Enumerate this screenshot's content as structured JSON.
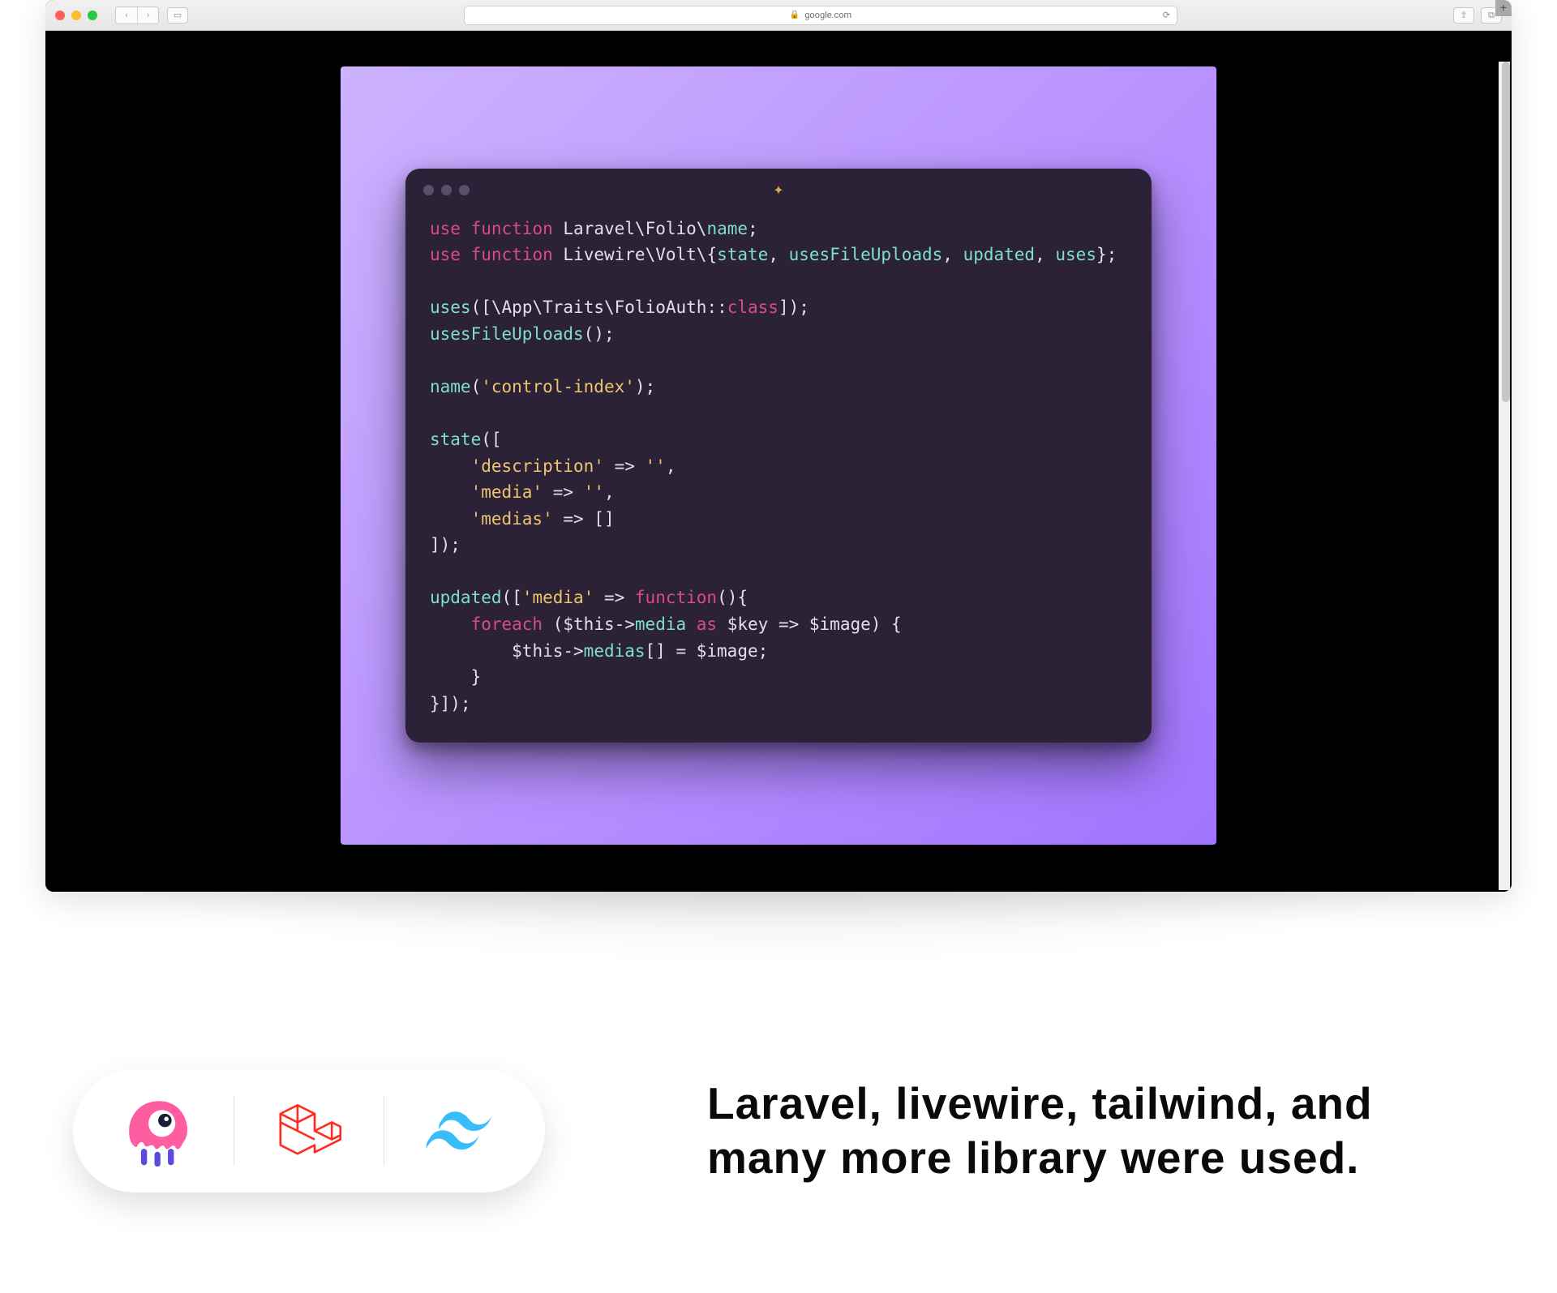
{
  "browser": {
    "url_display": "google.com",
    "traffic": [
      "close",
      "minimize",
      "zoom"
    ],
    "nav_back": "‹",
    "nav_fwd": "›",
    "sidebar_toggle": "▭",
    "share": "⇪",
    "tabs": "⧉"
  },
  "editor": {
    "sparkle": "✦",
    "code_tokens": [
      [
        {
          "c": "kw",
          "t": "use"
        },
        {
          "c": "op",
          "t": " "
        },
        {
          "c": "kw",
          "t": "function"
        },
        {
          "c": "op",
          "t": " "
        },
        {
          "c": "path",
          "t": "Laravel"
        },
        {
          "c": "bs",
          "t": "\\"
        },
        {
          "c": "path",
          "t": "Folio"
        },
        {
          "c": "bs",
          "t": "\\"
        },
        {
          "c": "teal",
          "t": "name"
        },
        {
          "c": "punc",
          "t": ";"
        }
      ],
      [
        {
          "c": "kw",
          "t": "use"
        },
        {
          "c": "op",
          "t": " "
        },
        {
          "c": "kw",
          "t": "function"
        },
        {
          "c": "op",
          "t": " "
        },
        {
          "c": "path",
          "t": "Livewire"
        },
        {
          "c": "bs",
          "t": "\\"
        },
        {
          "c": "path",
          "t": "Volt"
        },
        {
          "c": "bs",
          "t": "\\"
        },
        {
          "c": "brace",
          "t": "{"
        },
        {
          "c": "teal",
          "t": "state"
        },
        {
          "c": "punc",
          "t": ", "
        },
        {
          "c": "teal",
          "t": "usesFileUploads"
        },
        {
          "c": "punc",
          "t": ", "
        },
        {
          "c": "teal",
          "t": "updated"
        },
        {
          "c": "punc",
          "t": ", "
        },
        {
          "c": "teal",
          "t": "uses"
        },
        {
          "c": "brace",
          "t": "}"
        },
        {
          "c": "punc",
          "t": ";"
        }
      ],
      [],
      [
        {
          "c": "teal",
          "t": "uses"
        },
        {
          "c": "punc",
          "t": "(["
        },
        {
          "c": "bs",
          "t": "\\"
        },
        {
          "c": "path",
          "t": "App"
        },
        {
          "c": "bs",
          "t": "\\"
        },
        {
          "c": "path",
          "t": "Traits"
        },
        {
          "c": "bs",
          "t": "\\"
        },
        {
          "c": "path",
          "t": "FolioAuth"
        },
        {
          "c": "op",
          "t": "::"
        },
        {
          "c": "kw",
          "t": "class"
        },
        {
          "c": "punc",
          "t": "]);"
        }
      ],
      [
        {
          "c": "teal",
          "t": "usesFileUploads"
        },
        {
          "c": "punc",
          "t": "();"
        }
      ],
      [],
      [
        {
          "c": "teal",
          "t": "name"
        },
        {
          "c": "punc",
          "t": "("
        },
        {
          "c": "str",
          "t": "'control-index'"
        },
        {
          "c": "punc",
          "t": ");"
        }
      ],
      [],
      [
        {
          "c": "teal",
          "t": "state"
        },
        {
          "c": "punc",
          "t": "(["
        }
      ],
      [
        {
          "c": "punc",
          "t": "    "
        },
        {
          "c": "str",
          "t": "'description'"
        },
        {
          "c": "op",
          "t": " => "
        },
        {
          "c": "str",
          "t": "''"
        },
        {
          "c": "punc",
          "t": ","
        }
      ],
      [
        {
          "c": "punc",
          "t": "    "
        },
        {
          "c": "str",
          "t": "'media'"
        },
        {
          "c": "op",
          "t": " => "
        },
        {
          "c": "str",
          "t": "''"
        },
        {
          "c": "punc",
          "t": ","
        }
      ],
      [
        {
          "c": "punc",
          "t": "    "
        },
        {
          "c": "str",
          "t": "'medias'"
        },
        {
          "c": "op",
          "t": " => []"
        }
      ],
      [
        {
          "c": "punc",
          "t": "]);"
        }
      ],
      [],
      [
        {
          "c": "teal",
          "t": "updated"
        },
        {
          "c": "punc",
          "t": "(["
        },
        {
          "c": "str",
          "t": "'media'"
        },
        {
          "c": "op",
          "t": " => "
        },
        {
          "c": "kw",
          "t": "function"
        },
        {
          "c": "punc",
          "t": "(){"
        }
      ],
      [
        {
          "c": "punc",
          "t": "    "
        },
        {
          "c": "kw",
          "t": "foreach"
        },
        {
          "c": "punc",
          "t": " ("
        },
        {
          "c": "var",
          "t": "$this"
        },
        {
          "c": "op",
          "t": "->"
        },
        {
          "c": "teal",
          "t": "media"
        },
        {
          "c": "punc",
          "t": " "
        },
        {
          "c": "kw",
          "t": "as"
        },
        {
          "c": "punc",
          "t": " "
        },
        {
          "c": "var",
          "t": "$key"
        },
        {
          "c": "op",
          "t": " => "
        },
        {
          "c": "var",
          "t": "$image"
        },
        {
          "c": "punc",
          "t": ") {"
        }
      ],
      [
        {
          "c": "punc",
          "t": "        "
        },
        {
          "c": "var",
          "t": "$this"
        },
        {
          "c": "op",
          "t": "->"
        },
        {
          "c": "teal",
          "t": "medias"
        },
        {
          "c": "punc",
          "t": "[] = "
        },
        {
          "c": "var",
          "t": "$image"
        },
        {
          "c": "punc",
          "t": ";"
        }
      ],
      [
        {
          "c": "punc",
          "t": "    }"
        }
      ],
      [
        {
          "c": "punc",
          "t": "}]);"
        }
      ]
    ]
  },
  "footer": {
    "headline": "Laravel, livewire, tailwind, and many more library were used.",
    "logos": [
      "livewire-logo",
      "laravel-logo",
      "tailwind-logo"
    ]
  }
}
